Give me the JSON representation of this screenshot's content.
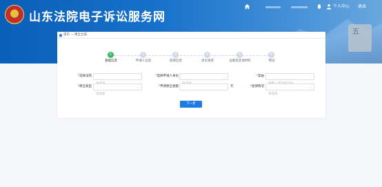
{
  "header": {
    "site_title": "山东法院电子诉讼服务网",
    "personal_center": "个人中心",
    "logout": "退出"
  },
  "background_text": "五",
  "breadcrumb": {
    "home": "首页",
    "separator": ">",
    "current": "保全立案"
  },
  "steps": [
    {
      "num": "1",
      "label": "基础信息",
      "active": true
    },
    {
      "num": "2",
      "label": "申请人信息",
      "active": false
    },
    {
      "num": "3",
      "label": "提请信息",
      "active": false
    },
    {
      "num": "4",
      "label": "诉讼请求",
      "active": false
    },
    {
      "num": "5",
      "label": "证据及其他材料",
      "active": false
    },
    {
      "num": "6",
      "label": "预览",
      "active": false
    }
  ],
  "form": {
    "court_label": "选择法院",
    "court_placeholder": "请选择",
    "applicant_identity_label": "选择申请人身份",
    "applicant_identity_placeholder": "请选择",
    "case_type_label": "案由",
    "case_type_placeholder": "请输入或选择案由",
    "preservation_type_label": "保全类型",
    "preservation_type_placeholder": "请选择",
    "amount_label": "申请保全金额",
    "amount_value": "",
    "amount_unit": "元",
    "guarantee_label": "担保情况",
    "guarantee_placeholder": "请选择"
  },
  "next_button": "下一步",
  "colors": {
    "banner_blue": "#0a5fb8",
    "active_step": "#38b96a",
    "primary_button": "#1e7be4",
    "required_mark": "#e33333"
  }
}
